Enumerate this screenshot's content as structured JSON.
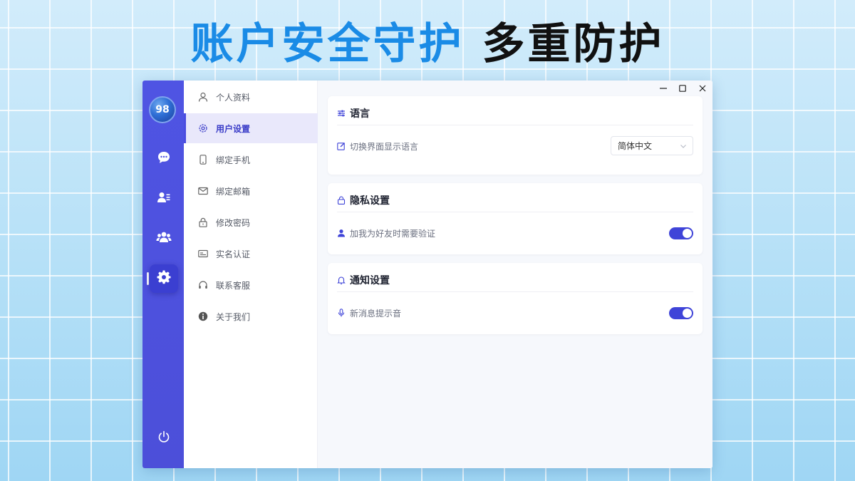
{
  "headline": {
    "blue": "账户安全守护",
    "black": "多重防护"
  },
  "rail": {
    "avatar_text": "98",
    "items": [
      {
        "icon": "chat-bubble-icon"
      },
      {
        "icon": "contacts-card-icon"
      },
      {
        "icon": "group-people-icon"
      },
      {
        "icon": "gear-icon",
        "active": true
      }
    ],
    "power_icon": "power-icon",
    "background": "#4f54e3"
  },
  "menu": {
    "items": [
      {
        "label": "个人资料",
        "icon": "user-icon"
      },
      {
        "label": "用户设置",
        "icon": "gear-icon",
        "active": true
      },
      {
        "label": "绑定手机",
        "icon": "phone-icon"
      },
      {
        "label": "绑定邮箱",
        "icon": "mail-icon"
      },
      {
        "label": "修改密码",
        "icon": "lock-icon"
      },
      {
        "label": "实名认证",
        "icon": "id-card-icon"
      },
      {
        "label": "联系客服",
        "icon": "headset-icon"
      },
      {
        "label": "关于我们",
        "icon": "info-icon"
      }
    ]
  },
  "window_controls": {
    "minimize": "─",
    "maximize": "□",
    "close": "✕"
  },
  "cards": {
    "language": {
      "title": "语言",
      "row_label": "切换界面显示语言",
      "select_value": "简体中文"
    },
    "privacy": {
      "title": "隐私设置",
      "row_label": "加我为好友时需要验证",
      "toggle_on": true
    },
    "notify": {
      "title": "通知设置",
      "row_label": "新消息提示音",
      "toggle_on": true
    }
  },
  "colors": {
    "accent": "#3f44d8",
    "headline_blue": "#1a8be6"
  }
}
